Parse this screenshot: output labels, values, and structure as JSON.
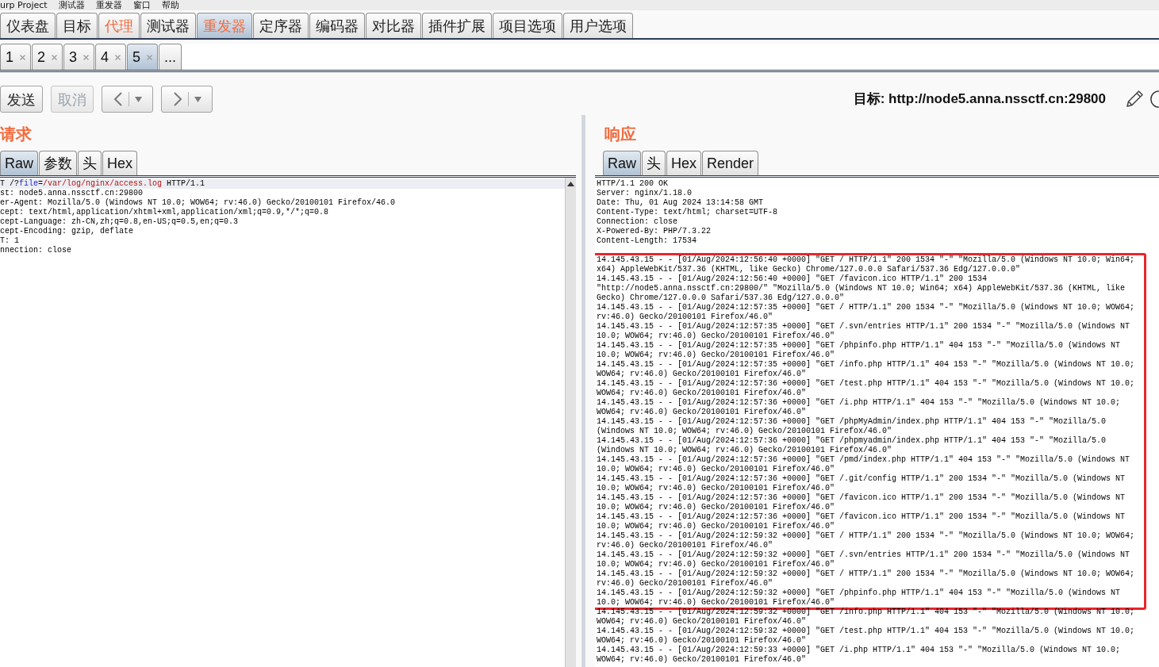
{
  "menu_bar": {
    "items": [
      "urp Project",
      "测试器",
      "重发器",
      "窗口",
      "帮助"
    ]
  },
  "main_tabs": [
    {
      "label": "仪表盘",
      "selected": false,
      "highlighted": false
    },
    {
      "label": "目标",
      "selected": false,
      "highlighted": false
    },
    {
      "label": "代理",
      "selected": false,
      "highlighted": true
    },
    {
      "label": "测试器",
      "selected": false,
      "highlighted": false
    },
    {
      "label": "重发器",
      "selected": true,
      "highlighted": true
    },
    {
      "label": "定序器",
      "selected": false,
      "highlighted": false
    },
    {
      "label": "编码器",
      "selected": false,
      "highlighted": false
    },
    {
      "label": "对比器",
      "selected": false,
      "highlighted": false
    },
    {
      "label": "插件扩展",
      "selected": false,
      "highlighted": false
    },
    {
      "label": "项目选项",
      "selected": false,
      "highlighted": false
    },
    {
      "label": "用户选项",
      "selected": false,
      "highlighted": false
    }
  ],
  "request_tabs": [
    {
      "kind": "closable",
      "label": "1",
      "selected": false
    },
    {
      "kind": "closable",
      "label": "2",
      "selected": false
    },
    {
      "kind": "closable",
      "label": "3",
      "selected": false
    },
    {
      "kind": "closable",
      "label": "4",
      "selected": false
    },
    {
      "kind": "closable",
      "label": "5",
      "selected": true
    },
    {
      "kind": "more",
      "label": "...",
      "selected": false
    }
  ],
  "toolbar": {
    "buttons": [
      {
        "kind": "text",
        "label": "发送",
        "disabled": false
      },
      {
        "kind": "text",
        "label": "取消",
        "disabled": true
      },
      {
        "kind": "back",
        "disabled": false
      },
      {
        "kind": "forward",
        "disabled": false
      }
    ],
    "target": "目标: http://node5.anna.nssctf.cn:29800"
  },
  "request": {
    "title": "请求",
    "tabs": [
      {
        "label": "Raw",
        "selected": true
      },
      {
        "label": "参数",
        "selected": false
      },
      {
        "label": "头",
        "selected": false
      },
      {
        "label": "Hex",
        "selected": false
      }
    ],
    "lines": [
      {
        "highlighted": true,
        "parts": [
          {
            "kind": "plain",
            "text": "T /?"
          },
          {
            "kind": "param_name",
            "text": "file"
          },
          {
            "kind": "plain",
            "text": "="
          },
          {
            "kind": "param_value",
            "text": "/var/log/nginx/access.log"
          },
          {
            "kind": "plain",
            "text": " HTTP/1.1"
          }
        ]
      },
      {
        "highlighted": false,
        "parts": [
          {
            "kind": "plain",
            "text": "st: node5.anna.nssctf.cn:29800"
          }
        ]
      },
      {
        "highlighted": false,
        "parts": [
          {
            "kind": "plain",
            "text": "er-Agent: Mozilla/5.0 (Windows NT 10.0; WOW64; rv:46.0) Gecko/20100101 Firefox/46.0"
          }
        ]
      },
      {
        "highlighted": false,
        "parts": [
          {
            "kind": "plain",
            "text": "cept: text/html,application/xhtml+xml,application/xml;q=0.9,*/*;q=0.8"
          }
        ]
      },
      {
        "highlighted": false,
        "parts": [
          {
            "kind": "plain",
            "text": "cept-Language: zh-CN,zh;q=0.8,en-US;q=0.5,en;q=0.3"
          }
        ]
      },
      {
        "highlighted": false,
        "parts": [
          {
            "kind": "plain",
            "text": "cept-Encoding: gzip, deflate"
          }
        ]
      },
      {
        "highlighted": false,
        "parts": [
          {
            "kind": "plain",
            "text": "T: 1"
          }
        ]
      },
      {
        "highlighted": false,
        "parts": [
          {
            "kind": "plain",
            "text": "nnection: close"
          }
        ]
      }
    ]
  },
  "response": {
    "title": "响应",
    "tabs": [
      {
        "label": "Raw",
        "selected": true
      },
      {
        "label": "头",
        "selected": false
      },
      {
        "label": "Hex",
        "selected": false
      },
      {
        "label": "Render",
        "selected": false
      }
    ],
    "header_lines": [
      "HTTP/1.1 200 OK",
      "Server: nginx/1.18.0",
      "Date: Thu, 01 Aug 2024 13:14:58 GMT",
      "Content-Type: text/html; charset=UTF-8",
      "Connection: close",
      "X-Powered-By: PHP/7.3.22",
      "Content-Length: 17534"
    ],
    "framed_log_entries": [
      "14.145.43.15 - - [01/Aug/2024:12:56:40 +0000] \"GET / HTTP/1.1\" 200 1534 \"-\" \"Mozilla/5.0 (Windows NT 10.0; Win64; x64) AppleWebKit/537.36 (KHTML, like Gecko) Chrome/127.0.0.0 Safari/537.36 Edg/127.0.0.0\"",
      "14.145.43.15 - - [01/Aug/2024:12:56:40 +0000] \"GET /favicon.ico HTTP/1.1\" 200 1534 \"http://node5.anna.nssctf.cn:29800/\" \"Mozilla/5.0 (Windows NT 10.0; Win64; x64) AppleWebKit/537.36 (KHTML, like Gecko) Chrome/127.0.0.0 Safari/537.36 Edg/127.0.0.0\"",
      "14.145.43.15 - - [01/Aug/2024:12:57:35 +0000] \"GET / HTTP/1.1\" 200 1534 \"-\" \"Mozilla/5.0 (Windows NT 10.0; WOW64; rv:46.0) Gecko/20100101 Firefox/46.0\"",
      "14.145.43.15 - - [01/Aug/2024:12:57:35 +0000] \"GET /.svn/entries HTTP/1.1\" 200 1534 \"-\" \"Mozilla/5.0 (Windows NT 10.0; WOW64; rv:46.0) Gecko/20100101 Firefox/46.0\"",
      "14.145.43.15 - - [01/Aug/2024:12:57:35 +0000] \"GET /phpinfo.php HTTP/1.1\" 404 153 \"-\" \"Mozilla/5.0 (Windows NT 10.0; WOW64; rv:46.0) Gecko/20100101 Firefox/46.0\"",
      "14.145.43.15 - - [01/Aug/2024:12:57:35 +0000] \"GET /info.php HTTP/1.1\" 404 153 \"-\" \"Mozilla/5.0 (Windows NT 10.0; WOW64; rv:46.0) Gecko/20100101 Firefox/46.0\"",
      "14.145.43.15 - - [01/Aug/2024:12:57:36 +0000] \"GET /test.php HTTP/1.1\" 404 153 \"-\" \"Mozilla/5.0 (Windows NT 10.0; WOW64; rv:46.0) Gecko/20100101 Firefox/46.0\"",
      "14.145.43.15 - - [01/Aug/2024:12:57:36 +0000] \"GET /i.php HTTP/1.1\" 404 153 \"-\" \"Mozilla/5.0 (Windows NT 10.0; WOW64; rv:46.0) Gecko/20100101 Firefox/46.0\"",
      "14.145.43.15 - - [01/Aug/2024:12:57:36 +0000] \"GET /phpMyAdmin/index.php HTTP/1.1\" 404 153 \"-\" \"Mozilla/5.0 (Windows NT 10.0; WOW64; rv:46.0) Gecko/20100101 Firefox/46.0\"",
      "14.145.43.15 - - [01/Aug/2024:12:57:36 +0000] \"GET /phpmyadmin/index.php HTTP/1.1\" 404 153 \"-\" \"Mozilla/5.0 (Windows NT 10.0; WOW64; rv:46.0) Gecko/20100101 Firefox/46.0\"",
      "14.145.43.15 - - [01/Aug/2024:12:57:36 +0000] \"GET /pmd/index.php HTTP/1.1\" 404 153 \"-\" \"Mozilla/5.0 (Windows NT 10.0; WOW64; rv:46.0) Gecko/20100101 Firefox/46.0\"",
      "14.145.43.15 - - [01/Aug/2024:12:57:36 +0000] \"GET /.git/config HTTP/1.1\" 200 1534 \"-\" \"Mozilla/5.0 (Windows NT 10.0; WOW64; rv:46.0) Gecko/20100101 Firefox/46.0\"",
      "14.145.43.15 - - [01/Aug/2024:12:57:36 +0000] \"GET /favicon.ico HTTP/1.1\" 200 1534 \"-\" \"Mozilla/5.0 (Windows NT 10.0; WOW64; rv:46.0) Gecko/20100101 Firefox/46.0\"",
      "14.145.43.15 - - [01/Aug/2024:12:57:36 +0000] \"GET /favicon.ico HTTP/1.1\" 200 1534 \"-\" \"Mozilla/5.0 (Windows NT 10.0; WOW64; rv:46.0) Gecko/20100101 Firefox/46.0\"",
      "14.145.43.15 - - [01/Aug/2024:12:59:32 +0000] \"GET / HTTP/1.1\" 200 1534 \"-\" \"Mozilla/5.0 (Windows NT 10.0; WOW64; rv:46.0) Gecko/20100101 Firefox/46.0\"",
      "14.145.43.15 - - [01/Aug/2024:12:59:32 +0000] \"GET /.svn/entries HTTP/1.1\" 200 1534 \"-\" \"Mozilla/5.0 (Windows NT 10.0; WOW64; rv:46.0) Gecko/20100101 Firefox/46.0\"",
      "14.145.43.15 - - [01/Aug/2024:12:59:32 +0000] \"GET / HTTP/1.1\" 200 1534 \"-\" \"Mozilla/5.0 (Windows NT 10.0; WOW64; rv:46.0) Gecko/20100101 Firefox/46.0\"",
      "14.145.43.15 - - [01/Aug/2024:12:59:32 +0000] \"GET /phpinfo.php HTTP/1.1\" 404 153 \"-\" \"Mozilla/5.0 (Windows NT 10.0; WOW64; rv:46.0) Gecko/20100101 Firefox/46.0\""
    ],
    "later_log_entries": [
      "14.145.43.15 - - [01/Aug/2024:12:59:32 +0000] \"GET /info.php HTTP/1.1\" 404 153 \"-\" \"Mozilla/5.0 (Windows NT 10.0; WOW64; rv:46.0) Gecko/20100101 Firefox/46.0\"",
      "14.145.43.15 - - [01/Aug/2024:12:59:32 +0000] \"GET /test.php HTTP/1.1\" 404 153 \"-\" \"Mozilla/5.0 (Windows NT 10.0; WOW64; rv:46.0) Gecko/20100101 Firefox/46.0\"",
      "14.145.43.15 - - [01/Aug/2024:12:59:33 +0000] \"GET /i.php HTTP/1.1\" 404 153 \"-\" \"Mozilla/5.0 (Windows NT 10.0; WOW64; rv:46.0) Gecko/20100101 Firefox/46.0\""
    ]
  }
}
